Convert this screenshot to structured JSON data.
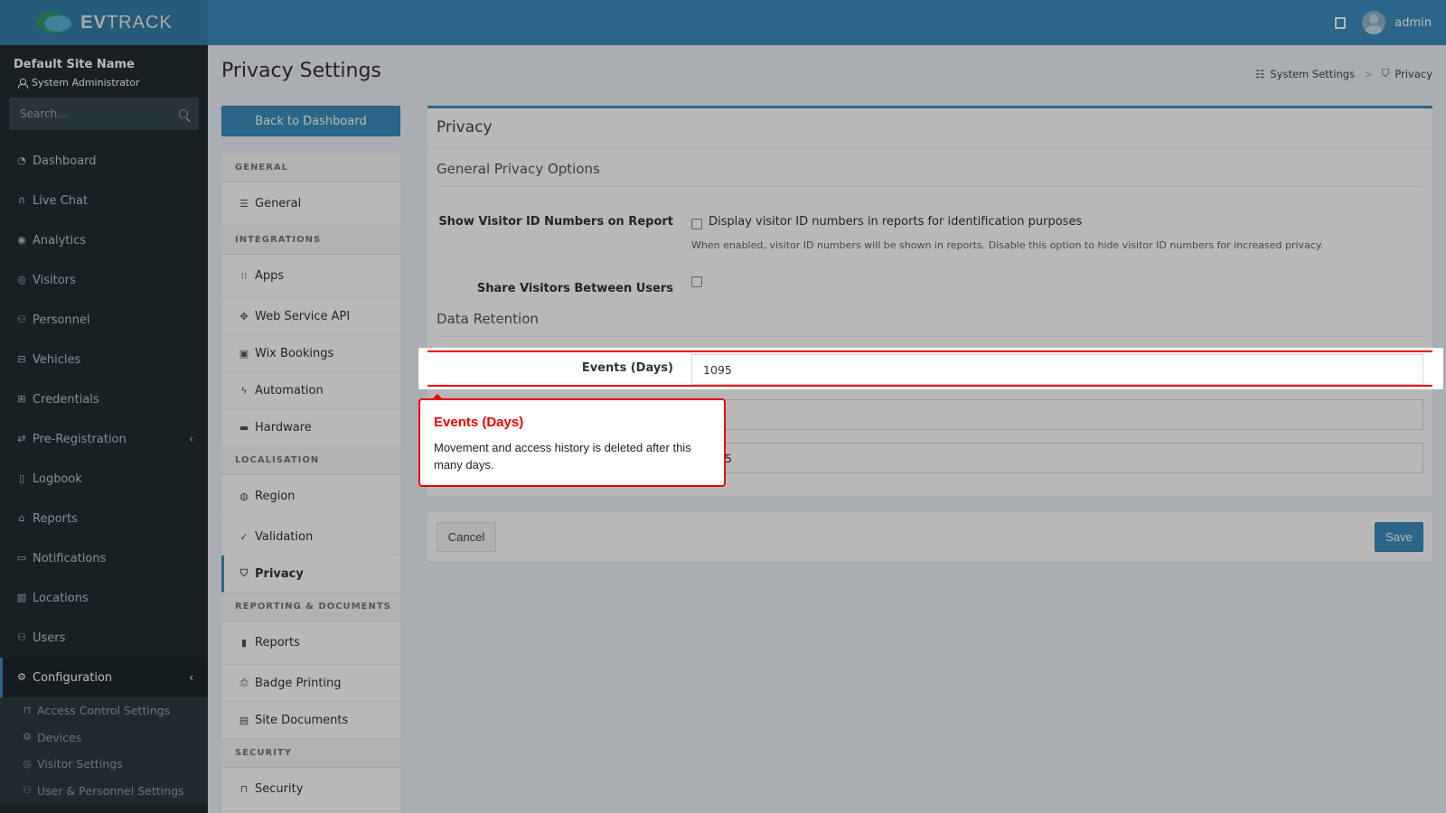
{
  "app": {
    "brand_bold": "EV",
    "brand_rest": "TRACK",
    "user": "admin"
  },
  "sidebar": {
    "site_name": "Default Site Name",
    "role": "System Administrator",
    "search_placeholder": "Search...",
    "items": [
      {
        "label": "Dashboard",
        "icon": "dashboard-icon",
        "glyph": "◔"
      },
      {
        "label": "Live Chat",
        "icon": "headset-icon",
        "glyph": "∩"
      },
      {
        "label": "Analytics",
        "icon": "analytics-icon",
        "glyph": "◉"
      },
      {
        "label": "Visitors",
        "icon": "eye-icon",
        "glyph": "◎"
      },
      {
        "label": "Personnel",
        "icon": "personnel-icon",
        "glyph": "⚇"
      },
      {
        "label": "Vehicles",
        "icon": "car-icon",
        "glyph": "⊟"
      },
      {
        "label": "Credentials",
        "icon": "credentials-icon",
        "glyph": "⊞"
      },
      {
        "label": "Pre-Registration",
        "icon": "pre-registration-icon",
        "glyph": "⇄"
      },
      {
        "label": "Logbook",
        "icon": "logbook-icon",
        "glyph": "▯"
      },
      {
        "label": "Reports",
        "icon": "reports-icon",
        "glyph": "⌂"
      },
      {
        "label": "Notifications",
        "icon": "notifications-icon",
        "glyph": "▭"
      },
      {
        "label": "Locations",
        "icon": "map-icon",
        "glyph": "▥"
      },
      {
        "label": "Users",
        "icon": "users-icon",
        "glyph": "⚇"
      },
      {
        "label": "Configuration",
        "icon": "gear-icon",
        "glyph": "⚙"
      }
    ],
    "sub_items": [
      {
        "label": "Access Control Settings",
        "icon": "lock-icon",
        "glyph": "⊓"
      },
      {
        "label": "Devices",
        "icon": "devices-icon",
        "glyph": "⚙"
      },
      {
        "label": "Visitor Settings",
        "icon": "eye-icon",
        "glyph": "◎"
      },
      {
        "label": "User & Personnel Settings",
        "icon": "user-settings-icon",
        "glyph": "⚇"
      }
    ]
  },
  "page": {
    "title": "Privacy Settings",
    "breadcrumb": {
      "parent": "System Settings",
      "current": "Privacy"
    },
    "back_button": "Back to Dashboard"
  },
  "settings_nav": {
    "sections": [
      {
        "header": "GENERAL",
        "items": [
          {
            "label": "General",
            "icon": "list-icon",
            "glyph": "☰"
          }
        ]
      },
      {
        "header": "INTEGRATIONS",
        "items": [
          {
            "label": "Apps",
            "icon": "apps-grid-icon",
            "glyph": "⁝⁝"
          },
          {
            "label": "Web Service API",
            "icon": "api-icon",
            "glyph": "✥"
          },
          {
            "label": "Wix Bookings",
            "icon": "calendar-icon",
            "glyph": "▣"
          },
          {
            "label": "Automation",
            "icon": "bolt-icon",
            "glyph": "ϟ"
          },
          {
            "label": "Hardware",
            "icon": "hardware-icon",
            "glyph": "▬"
          }
        ]
      },
      {
        "header": "LOCALISATION",
        "items": [
          {
            "label": "Region",
            "icon": "globe-icon",
            "glyph": "◍"
          },
          {
            "label": "Validation",
            "icon": "check-circle-icon",
            "glyph": "✓"
          },
          {
            "label": "Privacy",
            "icon": "shield-icon",
            "glyph": "⛉"
          }
        ]
      },
      {
        "header": "REPORTING & DOCUMENTS",
        "items": [
          {
            "label": "Reports",
            "icon": "bar-chart-icon",
            "glyph": "▮"
          },
          {
            "label": "Badge Printing",
            "icon": "printer-icon",
            "glyph": "⎙"
          },
          {
            "label": "Site Documents",
            "icon": "document-icon",
            "glyph": "▤"
          }
        ]
      },
      {
        "header": "SECURITY",
        "items": [
          {
            "label": "Security",
            "icon": "lock-icon",
            "glyph": "⊓"
          }
        ]
      }
    ]
  },
  "privacy": {
    "box_title": "Privacy",
    "general_section": "General Privacy Options",
    "show_visitor_id_label": "Show Visitor ID Numbers on Report",
    "show_visitor_id_checkbox": "Display visitor ID numbers in reports for identification purposes",
    "show_visitor_id_help": "When enabled, visitor ID numbers will be shown in reports. Disable this option to hide visitor ID numbers for increased privacy.",
    "share_visitors_label": "Share Visitors Between Users",
    "data_retention_section": "Data Retention",
    "events_label": "Events (Days)",
    "events_value": "1095",
    "field_2_value": "",
    "field_3_value": "5",
    "cancel": "Cancel",
    "save": "Save"
  },
  "tooltip": {
    "title": "Events (Days)",
    "body": "Movement and access history is deleted after this many days."
  },
  "colors": {
    "accent": "#3c8dbc",
    "sidebar": "#222d32",
    "highlight": "#e00000"
  }
}
